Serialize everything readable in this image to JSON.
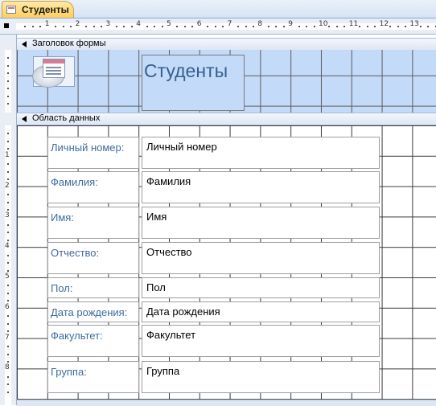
{
  "tab": {
    "label": "Студенты",
    "icon": "form-icon"
  },
  "ruler": {
    "h_numbers": [
      "1",
      "2",
      "3",
      "4",
      "5",
      "6",
      "7",
      "8",
      "9",
      "10",
      "11",
      "12",
      "13"
    ],
    "v_numbers": [
      "1",
      "2",
      "3",
      "4",
      "5",
      "6",
      "7",
      "8"
    ]
  },
  "sections": {
    "header_label": "Заголовок формы",
    "detail_label": "Область данных"
  },
  "form_header": {
    "title": "Студенты",
    "logo_icon": "form-logo-icon"
  },
  "fields": [
    {
      "label": "Личный номер:",
      "value": "Личный номер"
    },
    {
      "label": "Фамилия:",
      "value": "Фамилия"
    },
    {
      "label": "Имя:",
      "value": "Имя"
    },
    {
      "label": "Отчество:",
      "value": "Отчество"
    },
    {
      "label": "Пол:",
      "value": "Пол"
    },
    {
      "label": "Дата рождения:",
      "value": "Дата рождения"
    },
    {
      "label": "Факультет:",
      "value": "Факультет"
    },
    {
      "label": "Группа:",
      "value": "Группа"
    }
  ],
  "colors": {
    "header_background": "#c3daf9",
    "label_text": "#3d6b9e",
    "tab_accent": "#ffcf5a"
  }
}
